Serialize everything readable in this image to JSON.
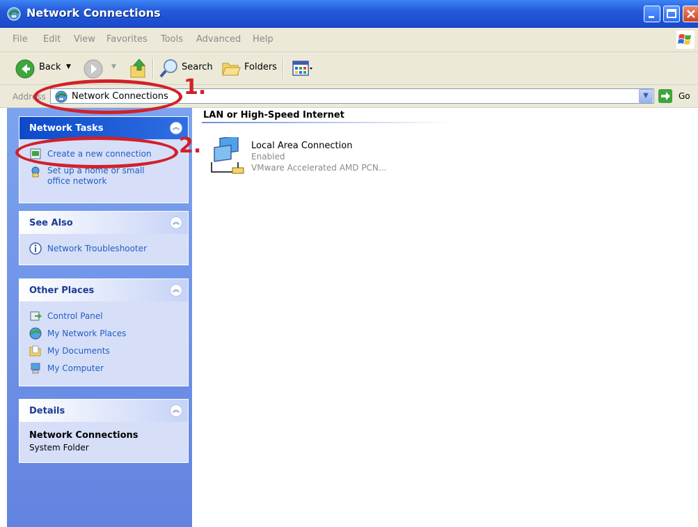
{
  "window": {
    "title": "Network Connections"
  },
  "menu": {
    "items": [
      "File",
      "Edit",
      "View",
      "Favorites",
      "Tools",
      "Advanced",
      "Help"
    ]
  },
  "toolbar": {
    "back_label": "Back",
    "search_label": "Search",
    "folders_label": "Folders"
  },
  "address": {
    "label": "Address",
    "value": "Network Connections",
    "go_label": "Go"
  },
  "panels": {
    "network_tasks": {
      "title": "Network Tasks",
      "items": [
        "Create a new connection",
        "Set up a home or small office network"
      ]
    },
    "see_also": {
      "title": "See Also",
      "items": [
        "Network Troubleshooter"
      ]
    },
    "other_places": {
      "title": "Other Places",
      "items": [
        "Control Panel",
        "My Network Places",
        "My Documents",
        "My Computer"
      ]
    },
    "details": {
      "title": "Details",
      "name": "Network Connections",
      "type": "System Folder"
    }
  },
  "content": {
    "group_header": "LAN or High-Speed Internet",
    "connection": {
      "name": "Local Area Connection",
      "status": "Enabled",
      "device": "VMware Accelerated AMD PCN..."
    }
  },
  "annotations": {
    "step1": "1.",
    "step2": "2."
  },
  "colors": {
    "title_bar": "#2459d9",
    "panel_bg": "#d6dff7",
    "link_text": "#215dc6",
    "annotation": "#d0212a"
  }
}
